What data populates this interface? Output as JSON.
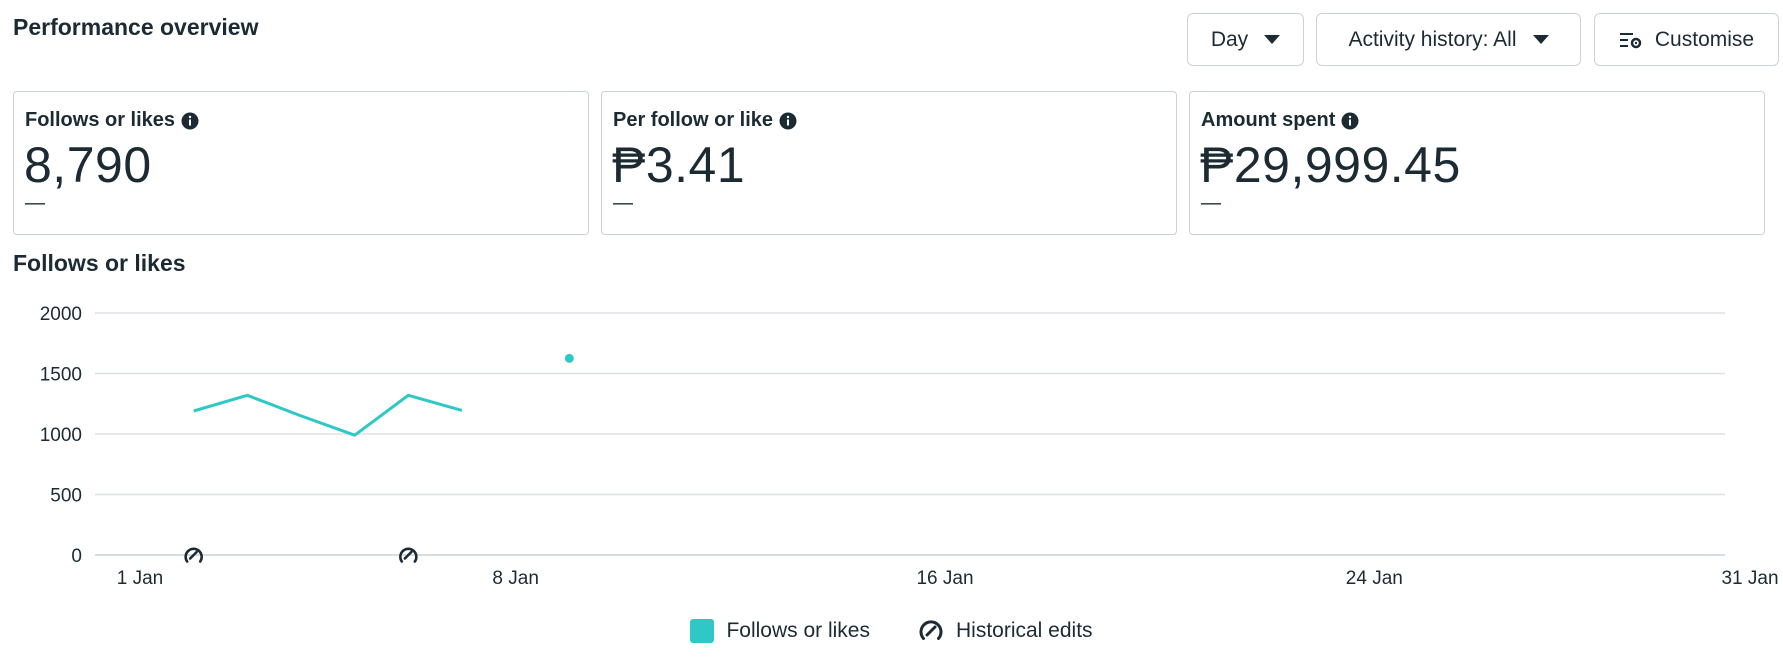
{
  "header": {
    "title": "Performance overview",
    "day_button": "Day",
    "activity_button": "Activity history: All",
    "customise_button": "Customise"
  },
  "cards": [
    {
      "label": "Follows or likes",
      "value": "8,790",
      "delta": "—"
    },
    {
      "label": "Per follow or like",
      "value": "₱3.41",
      "delta": "—"
    },
    {
      "label": "Amount spent",
      "value": "₱29,999.45",
      "delta": "—"
    }
  ],
  "chart_title": "Follows or likes",
  "chart_data": {
    "type": "line",
    "title": "Follows or likes",
    "xlabel": "",
    "ylabel": "",
    "ylim": [
      0,
      2000
    ],
    "yticks": [
      0,
      500,
      1000,
      1500,
      2000
    ],
    "xlim": [
      1,
      31
    ],
    "xticks": [
      {
        "day": 1,
        "label": "1 Jan"
      },
      {
        "day": 8,
        "label": "8 Jan"
      },
      {
        "day": 16,
        "label": "16 Jan"
      },
      {
        "day": 24,
        "label": "24 Jan"
      },
      {
        "day": 31,
        "label": "31 Jan"
      }
    ],
    "grid": true,
    "legend_position": "bottom-center",
    "series": [
      {
        "name": "Follows or likes",
        "color": "#2ec8c6",
        "points": [
          {
            "day": 2,
            "value": 1190
          },
          {
            "day": 3,
            "value": 1320
          },
          {
            "day": 4,
            "value": 1150
          },
          {
            "day": 5,
            "value": 990
          },
          {
            "day": 6,
            "value": 1320
          },
          {
            "day": 7,
            "value": 1195
          },
          {
            "day": 9,
            "value": 1625
          }
        ],
        "segments": [
          [
            0,
            5
          ],
          [
            6,
            6
          ]
        ]
      }
    ],
    "historical_edits": [
      2,
      6
    ]
  },
  "legend": {
    "series_label": "Follows or likes",
    "edits_label": "Historical edits",
    "series_color": "#2ec8c6",
    "edits_icon": "historical-edit-icon"
  }
}
